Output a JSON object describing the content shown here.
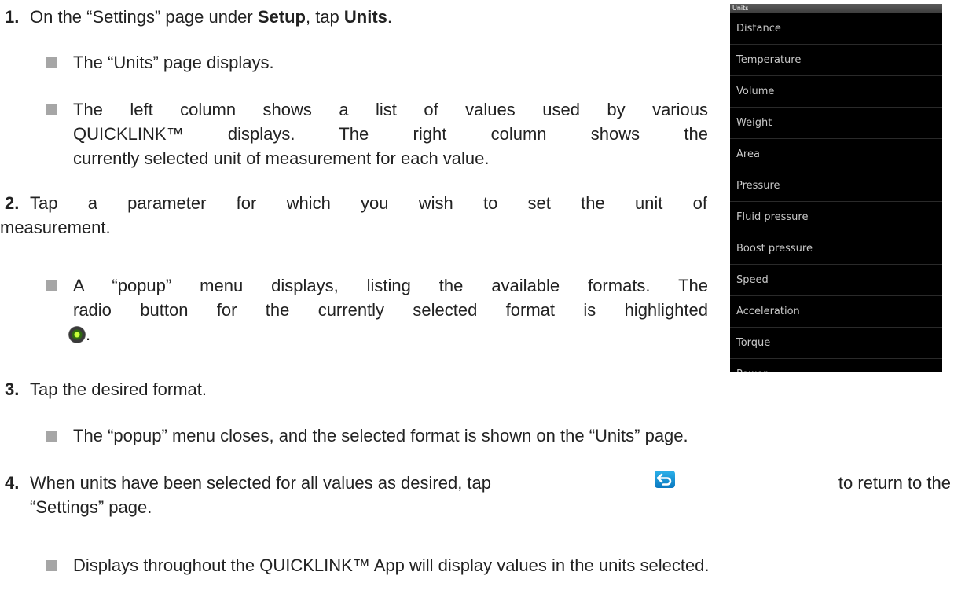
{
  "steps": [
    {
      "num": "1.",
      "pre": "On the “Settings” page under ",
      "b1": "Setup",
      "mid": ", tap ",
      "b2": "Units",
      "post": "."
    },
    {
      "num": "2.",
      "line1": "Tap a parameter for which you wish to set the unit of",
      "line2": "measurement."
    },
    {
      "num": "3.",
      "text": "Tap the desired format."
    },
    {
      "num": "4.",
      "line1a": "When units have been selected for all values as desired, tap",
      "line1b": "to return to the",
      "line2": "“Settings” page."
    }
  ],
  "bullets": {
    "b1": "The “Units” page displays.",
    "b2_l1": "The left column shows a list of values used by various",
    "b2_l2": "QUICKLINK™ displays. The right column shows the",
    "b2_l3": "currently selected unit of measurement for each value.",
    "b3_l1": "A “popup” menu displays, listing the available formats. The",
    "b3_l2": "radio button for the currently selected format is highlighted",
    "b3_l3": ".",
    "b4": "The “popup” menu closes, and the selected format is shown on the “Units” page.",
    "b5": "Displays throughout the QUICKLINK™ App will display values in the units selected."
  },
  "icons": {
    "radio": "radio-selected-icon",
    "back": "back-arrow-icon"
  },
  "phone": {
    "title": "Units",
    "items": [
      "Distance",
      "Temperature",
      "Volume",
      "Weight",
      "Area",
      "Pressure",
      "Fluid pressure",
      "Boost pressure",
      "Speed",
      "Acceleration",
      "Torque",
      "Power"
    ]
  }
}
